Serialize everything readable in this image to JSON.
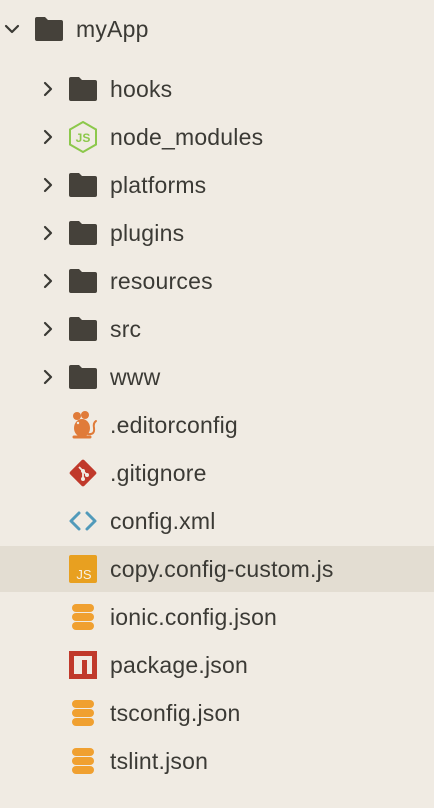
{
  "root": {
    "label": "myApp",
    "icon": "folder-icon",
    "expanded": true
  },
  "folders": [
    {
      "label": "hooks",
      "icon": "folder-icon"
    },
    {
      "label": "node_modules",
      "icon": "nodejs-icon"
    },
    {
      "label": "platforms",
      "icon": "folder-icon"
    },
    {
      "label": "plugins",
      "icon": "folder-icon"
    },
    {
      "label": "resources",
      "icon": "folder-icon"
    },
    {
      "label": "src",
      "icon": "folder-icon"
    },
    {
      "label": "www",
      "icon": "folder-icon"
    }
  ],
  "files": [
    {
      "label": ".editorconfig",
      "icon": "editorconfig-mouse-icon"
    },
    {
      "label": ".gitignore",
      "icon": "git-icon"
    },
    {
      "label": "config.xml",
      "icon": "code-brackets-icon"
    },
    {
      "label": "copy.config-custom.js",
      "icon": "js-file-icon",
      "selected": true
    },
    {
      "label": "ionic.config.json",
      "icon": "database-icon"
    },
    {
      "label": "package.json",
      "icon": "npm-icon"
    },
    {
      "label": "tsconfig.json",
      "icon": "database-icon"
    },
    {
      "label": "tslint.json",
      "icon": "database-icon"
    }
  ],
  "colors": {
    "background": "#f0ebe3",
    "selected_row": "#e3ddd2",
    "folder": "#45413a",
    "nodejs": "#8cc84b",
    "editorconfig": "#e07b39",
    "git": "#c0392b",
    "xml": "#519aba",
    "js": "#e8a020",
    "json": "#f0a030",
    "npm": "#c0392b"
  }
}
